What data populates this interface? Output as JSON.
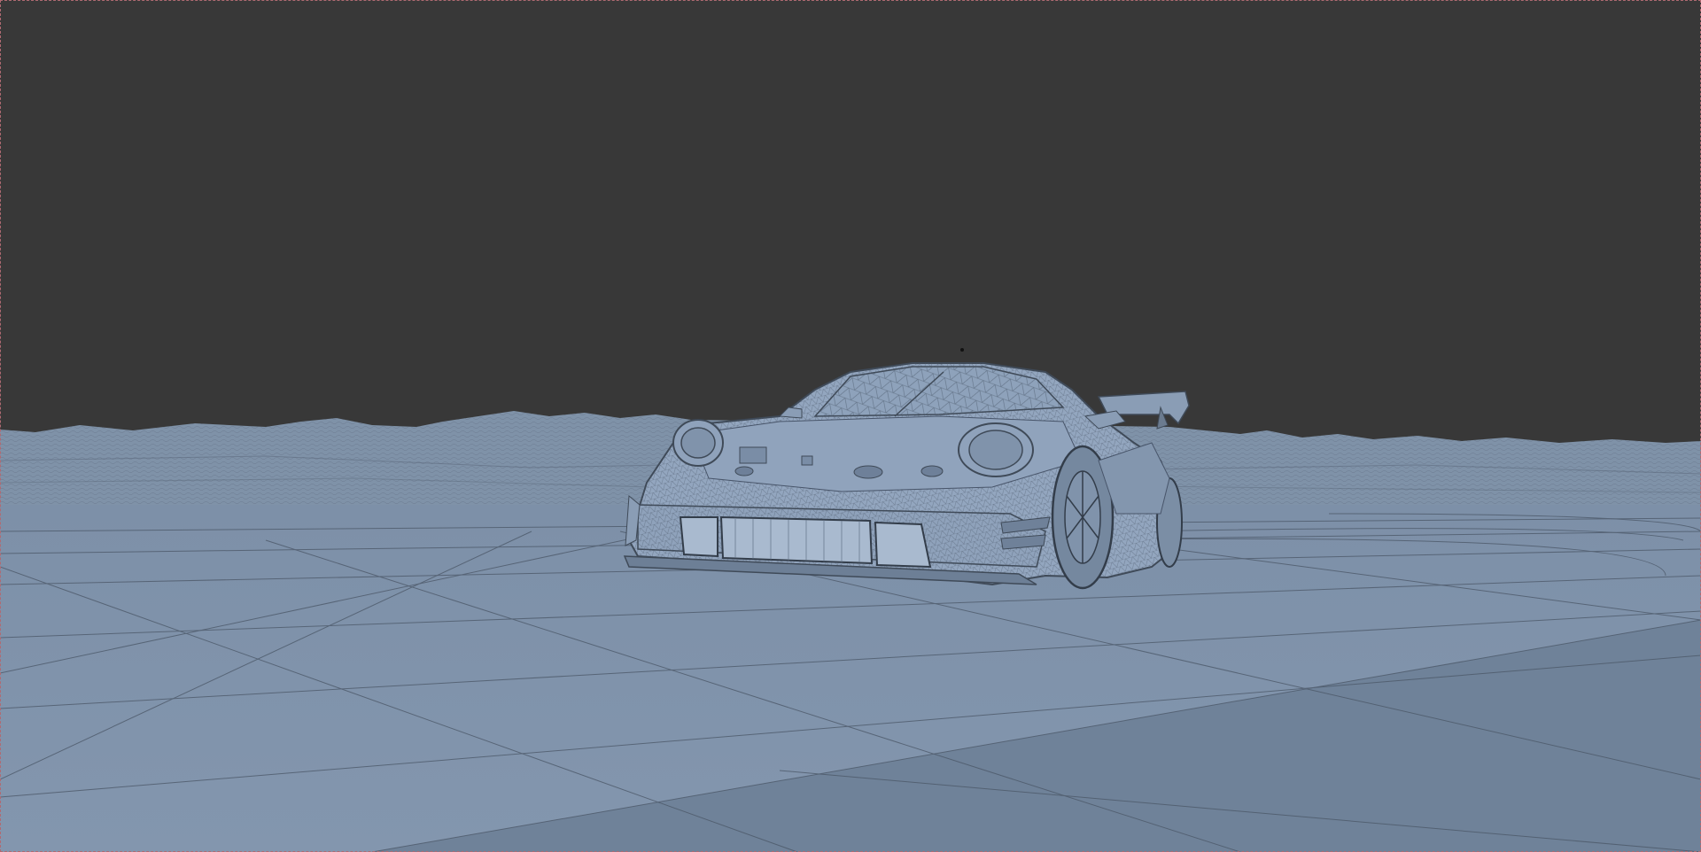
{
  "viewport": {
    "shading_mode": "wireframe-on-shaded",
    "colors": {
      "sky": "#383838",
      "terrain": "#7f92a8",
      "ground": "#8194ad",
      "ground_dark": "#6f8299",
      "wire": "#4a5666",
      "car_body": "#93a6bf",
      "car_dark": "#5e6d80",
      "frame": "#b06a72"
    },
    "objects": {
      "car": "race-car-wireframe-mesh",
      "terrain": "mountain-terrain-mesh",
      "ground": "track-ground-plane"
    }
  }
}
